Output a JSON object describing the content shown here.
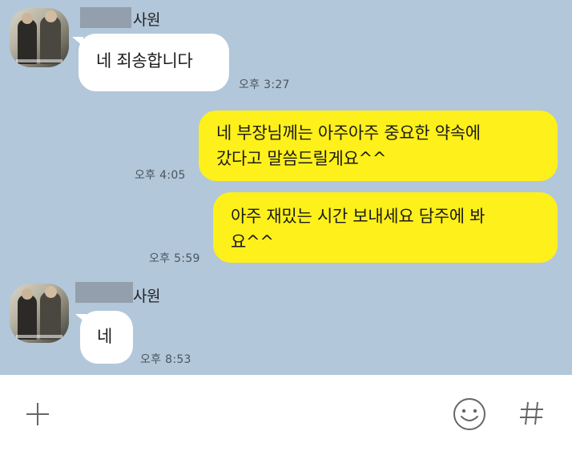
{
  "messages": [
    {
      "sender": "사원",
      "text": "네 죄송합니다",
      "time": "오후 3:27"
    },
    {
      "text_line1": "네 부장님께는 아주아주 중요한 약속에",
      "text_line2": "갔다고 말씀드릴게요^^",
      "time": "오후 4:05"
    },
    {
      "text_line1": "아주 재밌는 시간 보내세요 담주에 봐",
      "text_line2": "요^^",
      "time": "오후 5:59"
    },
    {
      "sender": "사원",
      "text": "네",
      "time": "오후 8:53"
    }
  ],
  "icons": {
    "add": "plus-icon",
    "emoji": "smile-icon",
    "hash": "hash-icon"
  },
  "colors": {
    "chat_background": "#b2c7d9",
    "my_bubble": "#fef01b",
    "their_bubble": "#ffffff"
  }
}
